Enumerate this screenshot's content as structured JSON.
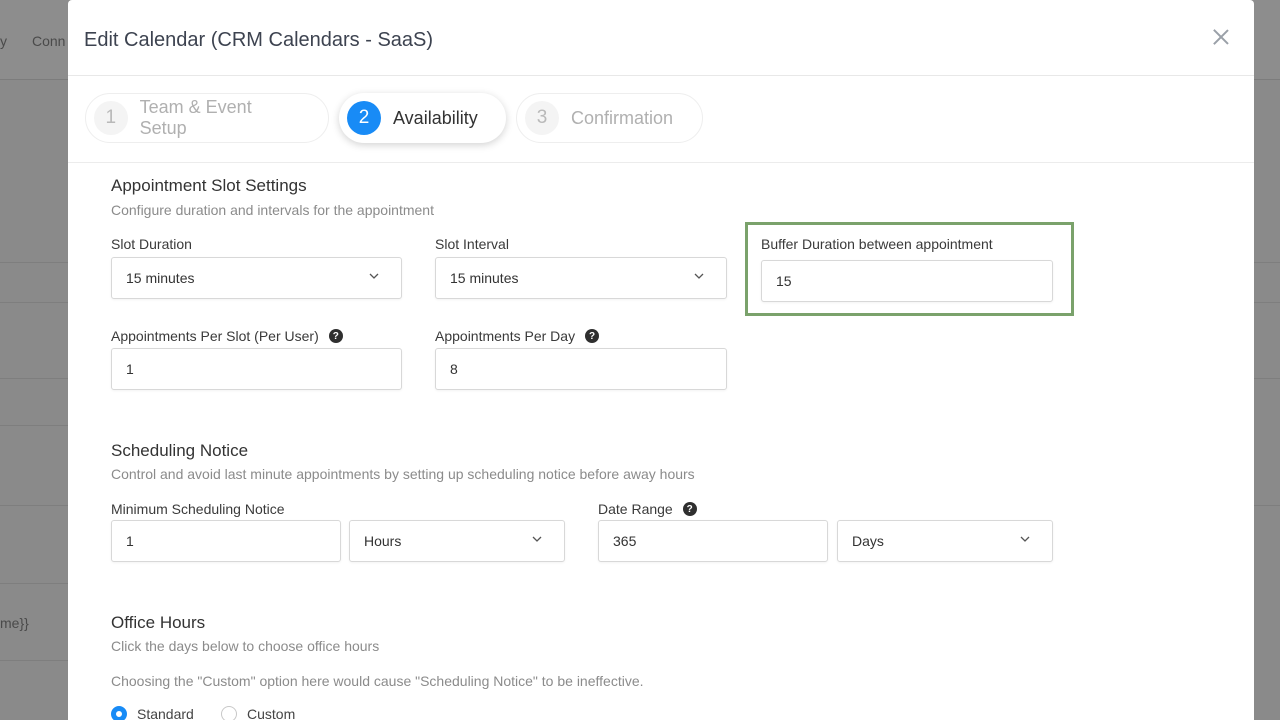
{
  "background": {
    "top_left_text_1": "y",
    "top_left_text_2": "Conn",
    "left_snippet": "me}}"
  },
  "modal": {
    "title": "Edit Calendar (CRM Calendars - SaaS)",
    "close_icon": "close-icon"
  },
  "steps": [
    {
      "number": "1",
      "label": "Team & Event Setup",
      "active": false
    },
    {
      "number": "2",
      "label": "Availability",
      "active": true
    },
    {
      "number": "3",
      "label": "Confirmation",
      "active": false
    }
  ],
  "slot_settings": {
    "title": "Appointment Slot Settings",
    "description": "Configure duration and intervals for the appointment",
    "slot_duration": {
      "label": "Slot Duration",
      "value": "15 minutes"
    },
    "slot_interval": {
      "label": "Slot Interval",
      "value": "15 minutes"
    },
    "buffer_duration": {
      "label": "Buffer Duration between appointment",
      "value": "15"
    },
    "appointments_per_slot": {
      "label": "Appointments Per Slot (Per User)",
      "value": "1"
    },
    "appointments_per_day": {
      "label": "Appointments Per Day",
      "value": "8"
    }
  },
  "scheduling_notice": {
    "title": "Scheduling Notice",
    "description": "Control and avoid last minute appointments by setting up scheduling notice before away hours",
    "minimum_notice": {
      "label": "Minimum Scheduling Notice",
      "value": "1",
      "unit": "Hours"
    },
    "date_range": {
      "label": "Date Range",
      "value": "365",
      "unit": "Days"
    }
  },
  "office_hours": {
    "title": "Office Hours",
    "description": "Click the days below to choose office hours",
    "note": "Choosing the \"Custom\" option here would cause \"Scheduling Notice\" to be ineffective.",
    "options": [
      {
        "label": "Standard",
        "checked": true
      },
      {
        "label": "Custom",
        "checked": false
      }
    ]
  },
  "colors": {
    "accent": "#188bf6",
    "highlight": "#7aa26b"
  }
}
